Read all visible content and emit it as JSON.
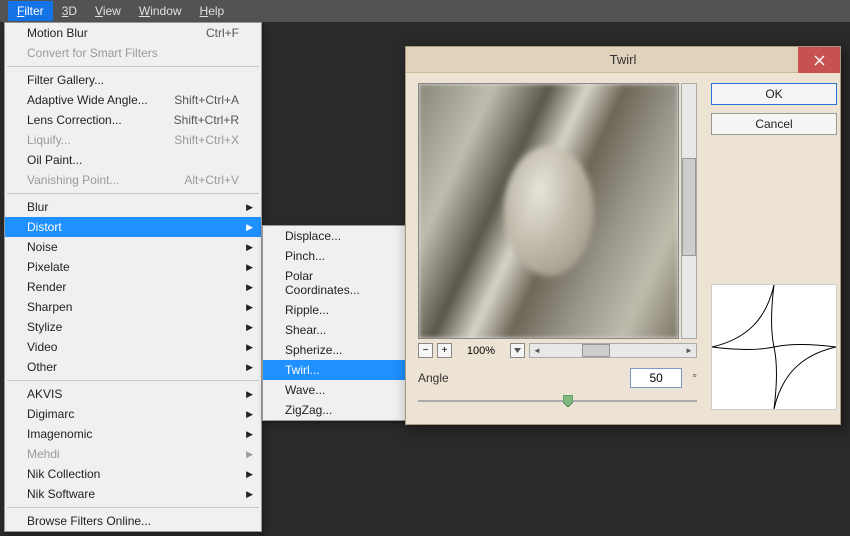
{
  "menubar": {
    "items": [
      "Filter",
      "3D",
      "View",
      "Window",
      "Help"
    ],
    "active_index": 0
  },
  "filter_menu": {
    "groups": [
      [
        {
          "label": "Motion Blur",
          "shortcut": "Ctrl+F"
        },
        {
          "label": "Convert for Smart Filters",
          "disabled": true
        }
      ],
      [
        {
          "label": "Filter Gallery..."
        },
        {
          "label": "Adaptive Wide Angle...",
          "shortcut": "Shift+Ctrl+A"
        },
        {
          "label": "Lens Correction...",
          "shortcut": "Shift+Ctrl+R"
        },
        {
          "label": "Liquify...",
          "shortcut": "Shift+Ctrl+X",
          "disabled": true
        },
        {
          "label": "Oil Paint..."
        },
        {
          "label": "Vanishing Point...",
          "shortcut": "Alt+Ctrl+V",
          "disabled": true
        }
      ],
      [
        {
          "label": "Blur",
          "submenu": true
        },
        {
          "label": "Distort",
          "submenu": true,
          "highlight": true
        },
        {
          "label": "Noise",
          "submenu": true
        },
        {
          "label": "Pixelate",
          "submenu": true
        },
        {
          "label": "Render",
          "submenu": true
        },
        {
          "label": "Sharpen",
          "submenu": true
        },
        {
          "label": "Stylize",
          "submenu": true
        },
        {
          "label": "Video",
          "submenu": true
        },
        {
          "label": "Other",
          "submenu": true
        }
      ],
      [
        {
          "label": "AKVIS",
          "submenu": true
        },
        {
          "label": "Digimarc",
          "submenu": true
        },
        {
          "label": "Imagenomic",
          "submenu": true
        },
        {
          "label": "Mehdi",
          "submenu": true,
          "disabled": true
        },
        {
          "label": "Nik Collection",
          "submenu": true
        },
        {
          "label": "Nik Software",
          "submenu": true
        }
      ],
      [
        {
          "label": "Browse Filters Online..."
        }
      ]
    ]
  },
  "distort_submenu": {
    "items": [
      {
        "label": "Displace..."
      },
      {
        "label": "Pinch..."
      },
      {
        "label": "Polar Coordinates..."
      },
      {
        "label": "Ripple..."
      },
      {
        "label": "Shear..."
      },
      {
        "label": "Spherize..."
      },
      {
        "label": "Twirl...",
        "highlight": true
      },
      {
        "label": "Wave..."
      },
      {
        "label": "ZigZag..."
      }
    ]
  },
  "dialog": {
    "title": "Twirl",
    "ok_label": "OK",
    "cancel_label": "Cancel",
    "zoom_value": "100%",
    "angle_label": "Angle",
    "angle_value": "50",
    "degree_symbol": "°"
  }
}
